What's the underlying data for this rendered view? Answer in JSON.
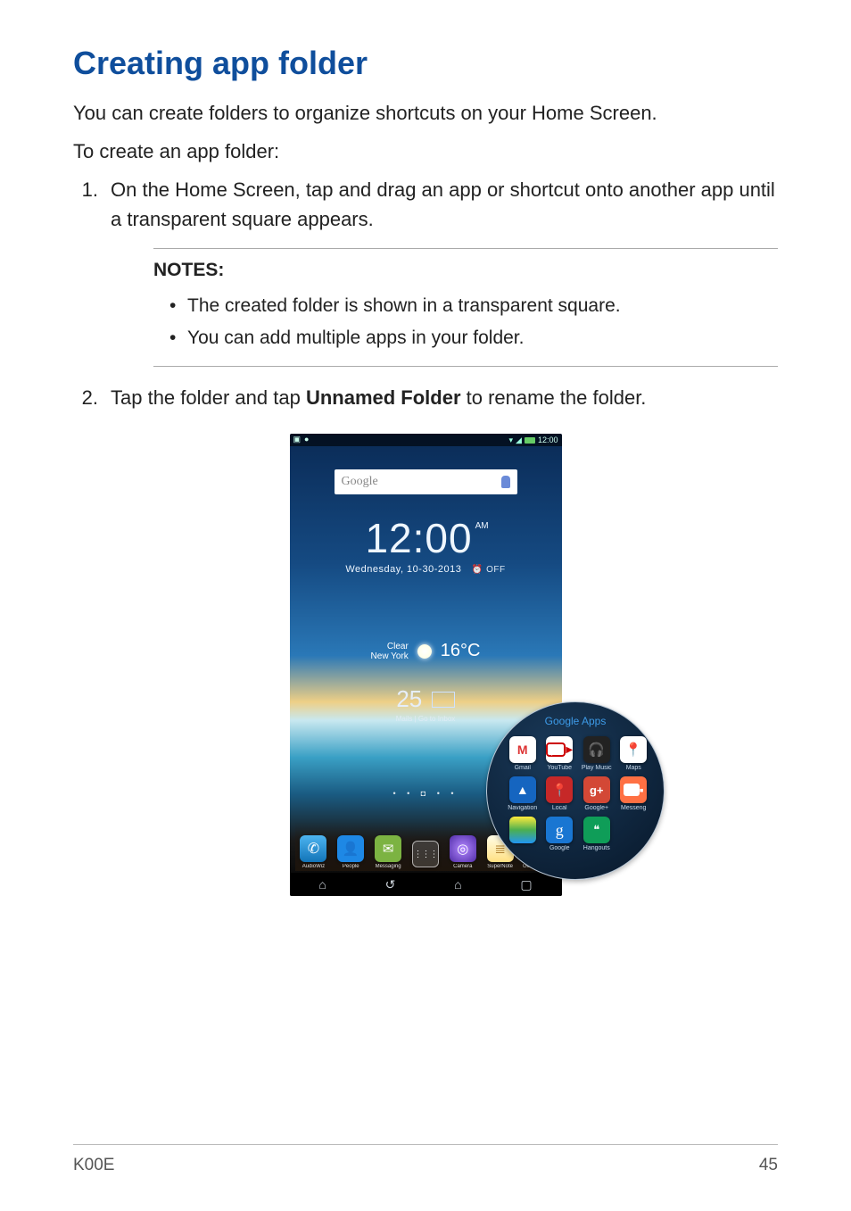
{
  "heading": "Creating app folder",
  "intro": "You can create folders to organize shortcuts on your Home Screen.",
  "lead": "To create an app folder:",
  "steps": {
    "s1_num": "1.",
    "s1_text": "On the Home Screen, tap and drag an app or shortcut onto another app until a transparent square appears.",
    "s2_num": "2.",
    "s2_pre": "Tap the folder and tap ",
    "s2_bold": "Unnamed Folder",
    "s2_post": " to rename the folder."
  },
  "notes": {
    "title": "NOTES:",
    "n1": "The created folder is shown in a transparent square.",
    "n2": "You can add multiple apps in your folder."
  },
  "screenshot": {
    "status": {
      "time": "12:00"
    },
    "search": {
      "placeholder": "Google"
    },
    "clock": {
      "time": "12:00",
      "ampm": "AM",
      "date": "Wednesday, 10-30-2013",
      "alarm": "⏰ OFF"
    },
    "weather": {
      "city_line1": "New York",
      "city_line2": "Clear",
      "temp": "16°C"
    },
    "mail": {
      "count": "25",
      "sub": "Mails | Go to Inbox"
    },
    "pager": "• • ◘ • •",
    "dock": {
      "d1": "AudioWiz",
      "d2": "People",
      "d3": "Messaging",
      "d4": "",
      "d5": "Camera",
      "d6": "SuperNote",
      "d7": "Google Ap..."
    },
    "bubble": {
      "title": "Google Apps",
      "apps": {
        "a1": "Gmail",
        "a2": "YouTube",
        "a3": "Play Music",
        "a4": "Maps",
        "a5": "Navigation",
        "a6": "Local",
        "a7": "Google+",
        "a8": "Messeng",
        "a9": "",
        "a10": "Google",
        "a11": "Hangouts",
        "a12": ""
      }
    }
  },
  "footer": {
    "model": "K00E",
    "page": "45"
  }
}
